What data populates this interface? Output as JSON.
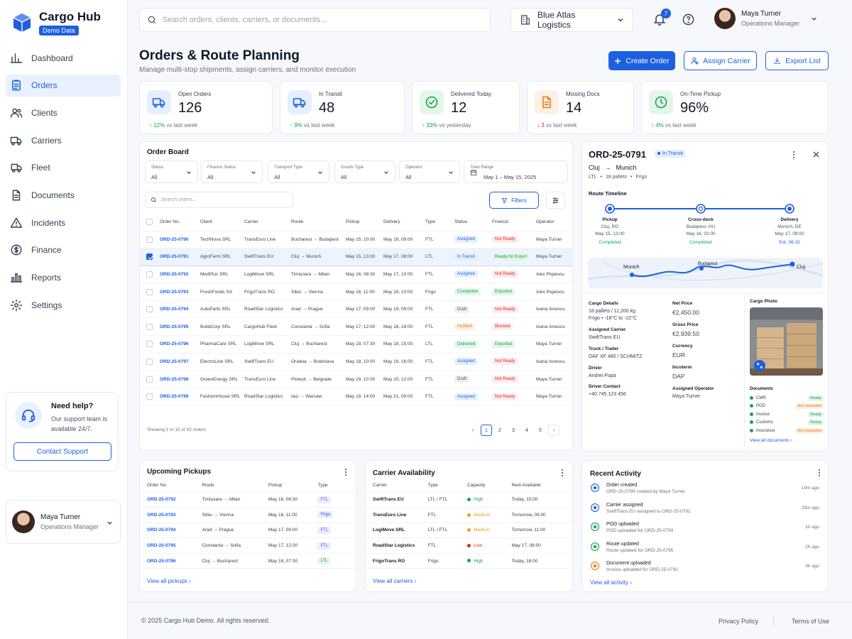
{
  "app": {
    "name": "Cargo Hub",
    "badge": "Demo Data"
  },
  "nav": [
    {
      "label": "Dashboard",
      "icon": "grid-icon"
    },
    {
      "label": "Orders",
      "icon": "clipboard-icon",
      "active": true
    },
    {
      "label": "Clients",
      "icon": "users-icon"
    },
    {
      "label": "Carriers",
      "icon": "truck-icon"
    },
    {
      "label": "Fleet",
      "icon": "van-icon"
    },
    {
      "label": "Documents",
      "icon": "document-icon"
    },
    {
      "label": "Incidents",
      "icon": "warning-icon"
    },
    {
      "label": "Finance",
      "icon": "dollar-icon"
    },
    {
      "label": "Reports",
      "icon": "bar-chart-icon"
    },
    {
      "label": "Settings",
      "icon": "gear-icon"
    }
  ],
  "help": {
    "title": "Need help?",
    "text": "Our support team is available 24/7.",
    "button": "Contact Support"
  },
  "user": {
    "name": "Maya Turner",
    "role": "Operations Manager"
  },
  "topbar": {
    "search_placeholder": "Search orders, clients, carriers, or documents...",
    "company": "Blue Atlas Logistics",
    "notifications": "7"
  },
  "page": {
    "title": "Orders & Route Planning",
    "subtitle": "Manage multi-stop shipments, assign carriers, and monitor execution"
  },
  "actions": {
    "create": "Create Order",
    "assign": "Assign Carrier",
    "export": "Export List"
  },
  "kpis": [
    {
      "label": "Open Orders",
      "value": "126",
      "delta": "12%",
      "delta_text": "vs last week",
      "trend": "up",
      "color": "#1d5fe0",
      "bg": "#e6efff",
      "icon": "truck-icon"
    },
    {
      "label": "In Transit",
      "value": "48",
      "delta": "9%",
      "delta_text": "vs last week",
      "trend": "up",
      "color": "#1d5fe0",
      "bg": "#e6efff",
      "icon": "truck-icon"
    },
    {
      "label": "Delivered Today",
      "value": "12",
      "delta": "33%",
      "delta_text": "vs yesterday",
      "trend": "up",
      "color": "#16a34a",
      "bg": "#e3f6ea",
      "icon": "check-circle-icon"
    },
    {
      "label": "Missing Docs",
      "value": "14",
      "delta": "3",
      "delta_text": "vs last week",
      "trend": "down",
      "color": "#ea7a17",
      "bg": "#fdf0e3",
      "icon": "document-icon"
    },
    {
      "label": "On-Time Pickup",
      "value": "96%",
      "delta": "4%",
      "delta_text": "vs last week",
      "trend": "up",
      "color": "#16a34a",
      "bg": "#e3f6ea",
      "icon": "clock-icon"
    }
  ],
  "board": {
    "title": "Order Board",
    "filters": [
      {
        "label": "Status",
        "value": "All"
      },
      {
        "label": "Finance Status",
        "value": "All"
      },
      {
        "label": "Transport Type",
        "value": "All"
      },
      {
        "label": "Goods Type",
        "value": "All"
      },
      {
        "label": "Operator",
        "value": "All"
      }
    ],
    "date_range": {
      "label": "Date Range",
      "value": "May 1 – May 15, 2025"
    },
    "search_placeholder": "Search orders...",
    "filters_button": "Filters",
    "columns": [
      "Order No.",
      "Client",
      "Carrier",
      "Route",
      "Pickup",
      "Delivery",
      "Type",
      "Status",
      "Finance",
      "Operator"
    ],
    "rows": [
      {
        "order": "ORD-25-0790",
        "client": "TechNova SRL",
        "carrier": "TransEuro Line",
        "route": "Bucharest → Budapest",
        "pickup": "May 15, 10:00",
        "delivery": "May 16, 09:00",
        "type": "FTL",
        "status": "Assigned",
        "status_c": "p-blue",
        "finance": "Not Ready",
        "finance_c": "p-red",
        "operator": "Maya Turner",
        "checked": false
      },
      {
        "order": "ORD-25-0791",
        "client": "AgroFarm SRL",
        "carrier": "SwiftTrans EU",
        "route": "Cluj → Munich",
        "pickup": "May 15, 13:00",
        "delivery": "May 17, 08:00",
        "type": "LTL",
        "status": "In Transit",
        "status_c": "p-blue",
        "finance": "Ready for Export",
        "finance_c": "p-green",
        "operator": "Maya Turner",
        "checked": true
      },
      {
        "order": "ORD-25-0792",
        "client": "MedPlus SRL",
        "carrier": "LogiMove SRL",
        "route": "Timișoara → Milan",
        "pickup": "May 16, 08:30",
        "delivery": "May 17, 15:00",
        "type": "FTL",
        "status": "Assigned",
        "status_c": "p-blue",
        "finance": "Not Ready",
        "finance_c": "p-red",
        "operator": "Alex Popescu",
        "checked": false
      },
      {
        "order": "ORD-25-0793",
        "client": "FreshFoods SA",
        "carrier": "FrigoTrans RO",
        "route": "Sibiu → Vienna",
        "pickup": "May 16, 11:00",
        "delivery": "May 18, 10:00",
        "type": "Frigo",
        "status": "Completed",
        "status_c": "p-green",
        "finance": "Exported",
        "finance_c": "p-green",
        "operator": "Alex Popescu",
        "checked": false
      },
      {
        "order": "ORD-25-0794",
        "client": "AutoParts SRL",
        "carrier": "RoadStar Logistics",
        "route": "Arad → Prague",
        "pickup": "May 17, 09:00",
        "delivery": "May 19, 09:00",
        "type": "FTL",
        "status": "Draft",
        "status_c": "p-gray",
        "finance": "Not Ready",
        "finance_c": "p-red",
        "operator": "Ioana Ionescu",
        "checked": false
      },
      {
        "order": "ORD-25-0795",
        "client": "BuildCorp SRL",
        "carrier": "CargoHub Fleet",
        "route": "Constanta → Sofia",
        "pickup": "May 17, 12:00",
        "delivery": "May 18, 18:00",
        "type": "FTL",
        "status": "Incident",
        "status_c": "p-orange",
        "finance": "Blocked",
        "finance_c": "p-red",
        "operator": "Ioana Ionescu",
        "checked": false
      },
      {
        "order": "ORD-25-0796",
        "client": "PharmaCare SRL",
        "carrier": "LogiMove SRL",
        "route": "Cluj → Bucharest",
        "pickup": "May 18, 07:30",
        "delivery": "May 18, 15:00",
        "type": "LTL",
        "status": "Delivered",
        "status_c": "p-green",
        "finance": "Exported",
        "finance_c": "p-green",
        "operator": "Maya Turner",
        "checked": false
      },
      {
        "order": "ORD-25-0797",
        "client": "ElectroLine SRL",
        "carrier": "SwiftTrans EU",
        "route": "Oradea → Bratislava",
        "pickup": "May 18, 10:00",
        "delivery": "May 19, 16:00",
        "type": "FTL",
        "status": "Assigned",
        "status_c": "p-blue",
        "finance": "Not Ready",
        "finance_c": "p-red",
        "operator": "Ioana Ionescu",
        "checked": false
      },
      {
        "order": "ORD-25-0798",
        "client": "GreenEnergy SRL",
        "carrier": "TransEuro Line",
        "route": "Ploiești → Belgrade",
        "pickup": "May 19, 10:00",
        "delivery": "May 20, 12:00",
        "type": "FTL",
        "status": "Draft",
        "status_c": "p-gray",
        "finance": "Not Ready",
        "finance_c": "p-red",
        "operator": "Maya Turner",
        "checked": false
      },
      {
        "order": "ORD-25-0799",
        "client": "FashionHouse SRL",
        "carrier": "RoadStar Logistics",
        "route": "Iași → Warsaw",
        "pickup": "May 19, 14:00",
        "delivery": "May 21, 09:00",
        "type": "FTL",
        "status": "Assigned",
        "status_c": "p-blue",
        "finance": "Not Ready",
        "finance_c": "p-red",
        "operator": "Maya Turner",
        "checked": false
      }
    ],
    "showing": "Showing 1 to 10 of 42 orders",
    "pages": [
      "1",
      "2",
      "3",
      "4",
      "5"
    ]
  },
  "detail": {
    "order": "ORD-25-0791",
    "status": "In Transit",
    "from": "Cluj",
    "to": "Munich",
    "meta1": "LTL",
    "meta2": "18 pallets",
    "meta3": "Frigo",
    "timeline_title": "Route Timeline",
    "stops": [
      {
        "name": "Pickup",
        "place": "Cluj, RO",
        "time": "May 15, 13:00",
        "state": "Completed"
      },
      {
        "name": "Cross-dock",
        "place": "Budapest, HU",
        "time": "May 16, 02:00",
        "state": "Completed"
      },
      {
        "name": "Delivery",
        "place": "Munich, DE",
        "time": "May 17, 08:00",
        "state": "Est. 08:15"
      }
    ],
    "map_labels": [
      "Munich",
      "Budapest",
      "Cluj"
    ],
    "cargo_label": "Cargo Details",
    "cargo_1": "18 pallets / 11,200 kg",
    "cargo_2": "Frigo  •  -18°C to -22°C",
    "carrier_label": "Assigned Carrier",
    "carrier": "SwiftTrans EU",
    "truck_label": "Truck / Trailer",
    "truck": "DAF XF 480 / SCHMITZ",
    "driver_label": "Driver",
    "driver": "Andrei Popa",
    "contact_label": "Driver Contact",
    "contact": "+40 745 123 456",
    "net_label": "Net Price",
    "net": "€2,450.00",
    "gross_label": "Gross Price",
    "gross": "€2,939.50",
    "currency_label": "Currency",
    "currency": "EUR",
    "incoterm_label": "Incoterm",
    "incoterm": "DAP",
    "operator_label": "Assigned Operator",
    "operator": "Maya Turner",
    "photo_label": "Cargo Photo",
    "docs_label": "Documents",
    "docs": [
      {
        "name": "CMR",
        "status": "Ready",
        "c": "p-green"
      },
      {
        "name": "POD",
        "status": "Not Uploaded",
        "c": "p-orange"
      },
      {
        "name": "Invoice",
        "status": "Ready",
        "c": "p-green"
      },
      {
        "name": "Customs",
        "status": "Ready",
        "c": "p-green"
      },
      {
        "name": "Insurance",
        "status": "Not Uploaded",
        "c": "p-orange"
      }
    ],
    "docs_link": "View all documents"
  },
  "pickups": {
    "title": "Upcoming Pickups",
    "columns": [
      "Order No.",
      "Route",
      "Pickup",
      "Type"
    ],
    "rows": [
      {
        "order": "ORD-25-0792",
        "route": "Timișoara → Milan",
        "pickup": "May 16, 08:30",
        "type": "FTL",
        "c": "p-purple"
      },
      {
        "order": "ORD-25-0793",
        "route": "Sibiu → Vienna",
        "pickup": "May 16, 11:00",
        "type": "Frigo",
        "c": "p-blue"
      },
      {
        "order": "ORD-25-0794",
        "route": "Arad → Prague",
        "pickup": "May 17, 09:00",
        "type": "FTL",
        "c": "p-purple"
      },
      {
        "order": "ORD-25-0795",
        "route": "Constanta → Sofia",
        "pickup": "May 17, 12:00",
        "type": "FTL",
        "c": "p-purple"
      },
      {
        "order": "ORD-25-0796",
        "route": "Cluj → Bucharest",
        "pickup": "May 18, 07:30",
        "type": "LTL",
        "c": "p-green"
      }
    ],
    "link": "View all pickups"
  },
  "carriers": {
    "title": "Carrier Availability",
    "columns": [
      "Carrier",
      "Type",
      "Capacity",
      "Next Available"
    ],
    "rows": [
      {
        "carrier": "SwiftTrans EU",
        "type": "LTL / FTL",
        "capacity": "High",
        "color": "#16a34a",
        "next": "Today, 15:00"
      },
      {
        "carrier": "TransEuro Line",
        "type": "FTL",
        "capacity": "Medium",
        "color": "#f0a21b",
        "next": "Tomorrow, 09:00"
      },
      {
        "carrier": "LogiMove SRL",
        "type": "LTL / FTL",
        "capacity": "Medium",
        "color": "#f0a21b",
        "next": "Tomorrow, 11:00"
      },
      {
        "carrier": "RoadStar Logistics",
        "type": "FTL",
        "capacity": "Low",
        "color": "#dc2626",
        "next": "May 17, 08:00"
      },
      {
        "carrier": "FrigoTrans RO",
        "type": "Frigo",
        "capacity": "High",
        "color": "#16a34a",
        "next": "Today, 18:00"
      }
    ],
    "link": "View all carriers"
  },
  "activity": {
    "title": "Recent Activity",
    "items": [
      {
        "title": "Order created",
        "sub": "ORD-25-0799 created by Maya Turner",
        "time": "10m ago",
        "color": "#1d5fe0",
        "bg": "#e6efff"
      },
      {
        "title": "Carrier assigned",
        "sub": "SwiftTrans EU assigned to ORD-25-0791",
        "time": "25m ago",
        "color": "#1d5fe0",
        "bg": "#e6efff"
      },
      {
        "title": "POD uploaded",
        "sub": "POD uploaded for ORD-25-0793",
        "time": "1h ago",
        "color": "#16a34a",
        "bg": "#e3f6ea"
      },
      {
        "title": "Route updated",
        "sub": "Route updated for ORD-25-0795",
        "time": "2h ago",
        "color": "#16a34a",
        "bg": "#e3f6ea"
      },
      {
        "title": "Document uploaded",
        "sub": "Invoice uploaded for ORD-25-0792",
        "time": "3h ago",
        "color": "#ea7a17",
        "bg": "#fdf0e3"
      }
    ],
    "link": "View all activity"
  },
  "footer": {
    "copyright": "© 2025 Cargo Hub Demo. All rights reserved.",
    "privacy": "Privacy Policy",
    "terms": "Terms of Use"
  }
}
